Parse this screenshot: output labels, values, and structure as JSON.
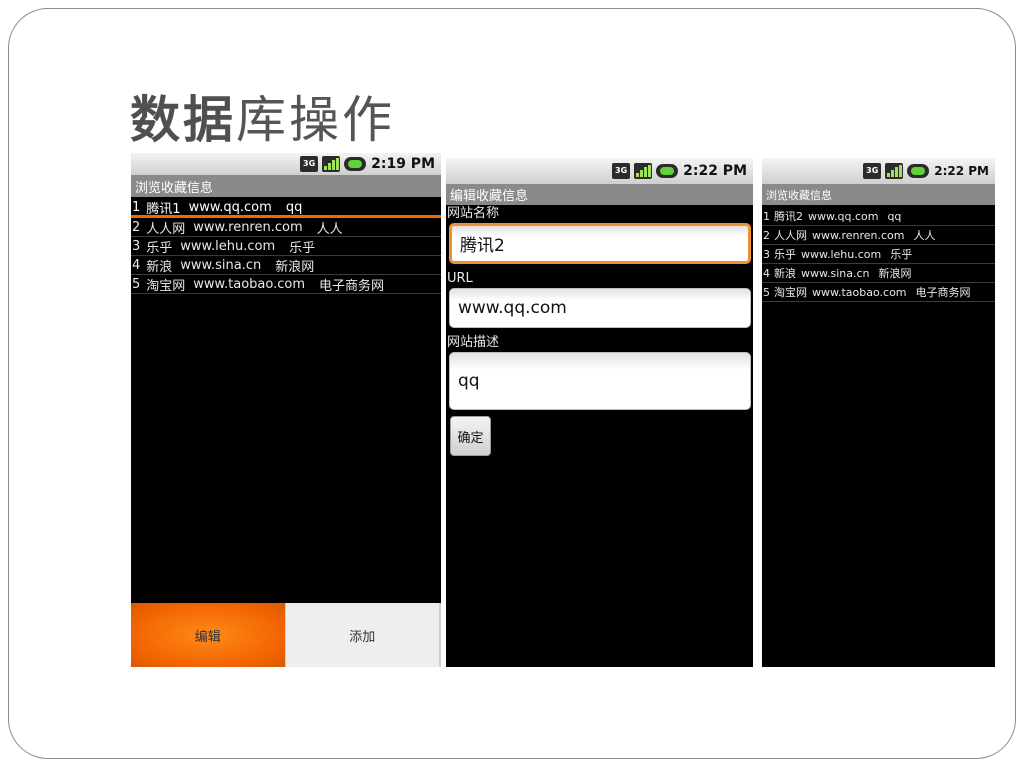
{
  "slide": {
    "title_bold": "数据",
    "title_rest": "库操作"
  },
  "phone1": {
    "status_time": "2:19 PM",
    "title": "浏览收藏信息",
    "rows": [
      {
        "id": "1",
        "name": "腾讯1",
        "url": "www.qq.com",
        "desc": "qq"
      },
      {
        "id": "2",
        "name": "人人网",
        "url": "www.renren.com",
        "desc": "人人"
      },
      {
        "id": "3",
        "name": "乐乎",
        "url": "www.lehu.com",
        "desc": "乐乎"
      },
      {
        "id": "4",
        "name": "新浪",
        "url": "www.sina.cn",
        "desc": "新浪网"
      },
      {
        "id": "5",
        "name": "淘宝网",
        "url": "www.taobao.com",
        "desc": "电子商务网"
      }
    ],
    "edit_button": "编辑",
    "add_button": "添加"
  },
  "phone2": {
    "status_time": "2:22 PM",
    "title": "编辑收藏信息",
    "name_label": "网站名称",
    "name_value": "腾讯2",
    "url_label": "URL",
    "url_value": "www.qq.com",
    "desc_label": "网站描述",
    "desc_value": "qq",
    "confirm_button": "确定"
  },
  "phone3": {
    "status_time": "2:22 PM",
    "title": "浏览收藏信息",
    "rows": [
      {
        "id": "1",
        "name": "腾讯2",
        "url": "www.qq.com",
        "desc": "qq"
      },
      {
        "id": "2",
        "name": "人人网",
        "url": "www.renren.com",
        "desc": "人人"
      },
      {
        "id": "3",
        "name": "乐乎",
        "url": "www.lehu.com",
        "desc": "乐乎"
      },
      {
        "id": "4",
        "name": "新浪",
        "url": "www.sina.cn",
        "desc": "新浪网"
      },
      {
        "id": "5",
        "name": "淘宝网",
        "url": "www.taobao.com",
        "desc": "电子商务网"
      }
    ]
  },
  "colors": {
    "accent": "#f26400",
    "focus_border": "#f0922f",
    "titlebar": "#8a8a8a"
  },
  "icons": [
    "3g-icon",
    "signal-icon",
    "battery-icon"
  ]
}
